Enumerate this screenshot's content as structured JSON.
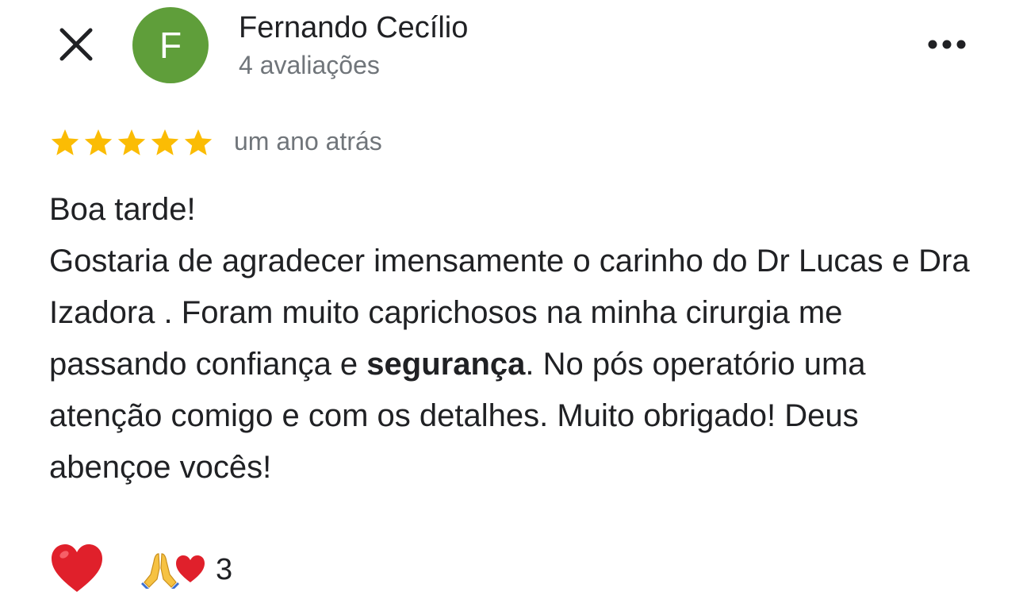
{
  "author": {
    "initial": "F",
    "name": "Fernando Cecílio",
    "review_count": "4 avaliações",
    "avatar_color": "#5f9e3a"
  },
  "review": {
    "rating": 5,
    "max_rating": 5,
    "time": "um ano atrás",
    "star_color": "#fbbc04",
    "paragraphs": [
      {
        "segments": [
          {
            "text": "Boa tarde!",
            "bold": false
          }
        ]
      },
      {
        "segments": [
          {
            "text": "Gostaria de agradecer imensamente o carinho do Dr Lucas e Dra Izadora . Foram muito caprichosos na minha cirurgia me passando confiança e ",
            "bold": false
          },
          {
            "text": "segurança",
            "bold": true
          },
          {
            "text": ". No pós operatório uma atenção comigo e com os detalhes. Muito obrigado! Deus abençoe vocês!",
            "bold": false
          }
        ]
      }
    ]
  },
  "reactions": {
    "action_icon": "heart-icon",
    "icons": [
      "pray-icon",
      "heart-icon"
    ],
    "count": "3",
    "heart_color": "#e0202b"
  },
  "icons": {
    "close": "close-icon",
    "more": "more-horizontal-icon"
  }
}
